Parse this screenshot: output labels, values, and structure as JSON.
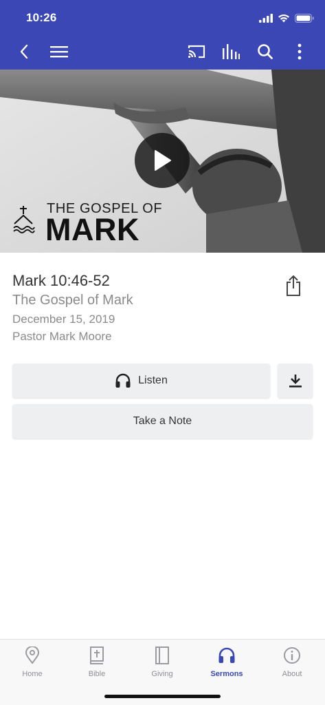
{
  "status_bar": {
    "time": "10:26"
  },
  "toolbar": {
    "icons": [
      "back-icon",
      "menu-icon",
      "cast-icon",
      "audio-bars-icon",
      "search-icon",
      "more-icon"
    ],
    "accent_color": "#3a47b4"
  },
  "hero": {
    "series_line1": "THE GOSPEL OF",
    "series_line2": "MARK",
    "play_icon": "play-icon"
  },
  "sermon": {
    "title": "Mark 10:46-52",
    "series": "The Gospel of Mark",
    "date": "December 15, 2019",
    "speaker": "Pastor Mark Moore"
  },
  "actions": {
    "listen_label": "Listen",
    "note_label": "Take a Note",
    "download_icon": "download-icon",
    "share_icon": "share-icon"
  },
  "tabs": [
    {
      "label": "Home",
      "icon": "location-pin-icon",
      "active": false
    },
    {
      "label": "Bible",
      "icon": "bible-icon",
      "active": false
    },
    {
      "label": "Giving",
      "icon": "giving-icon",
      "active": false
    },
    {
      "label": "Sermons",
      "icon": "headphones-icon",
      "active": true
    },
    {
      "label": "About",
      "icon": "info-icon",
      "active": false
    }
  ]
}
